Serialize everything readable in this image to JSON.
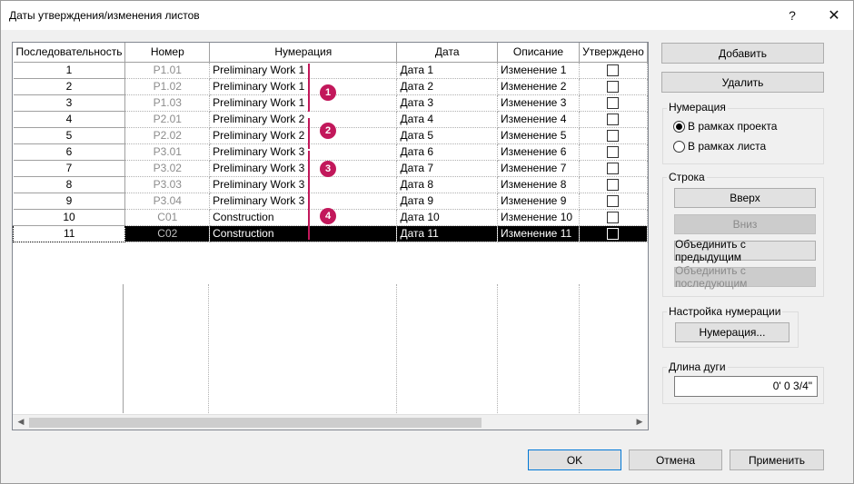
{
  "window": {
    "title": "Даты утверждения/изменения листов",
    "help_label": "?",
    "close_label": "✕"
  },
  "table": {
    "columns": [
      "Последовательность",
      "Номер",
      "Нумерация",
      "Дата",
      "Описание",
      "Утверждено"
    ],
    "rows": [
      {
        "seq": "1",
        "num": "P1.01",
        "numbering": "Preliminary Work 1",
        "date": "Дата 1",
        "desc": "Изменение 1",
        "approved": false
      },
      {
        "seq": "2",
        "num": "P1.02",
        "numbering": "Preliminary Work 1",
        "date": "Дата 2",
        "desc": "Изменение 2",
        "approved": false
      },
      {
        "seq": "3",
        "num": "P1.03",
        "numbering": "Preliminary Work 1",
        "date": "Дата 3",
        "desc": "Изменение 3",
        "approved": false
      },
      {
        "seq": "4",
        "num": "P2.01",
        "numbering": "Preliminary Work 2",
        "date": "Дата 4",
        "desc": "Изменение 4",
        "approved": false
      },
      {
        "seq": "5",
        "num": "P2.02",
        "numbering": "Preliminary Work 2",
        "date": "Дата 5",
        "desc": "Изменение 5",
        "approved": false
      },
      {
        "seq": "6",
        "num": "P3.01",
        "numbering": "Preliminary Work 3",
        "date": "Дата 6",
        "desc": "Изменение 6",
        "approved": false
      },
      {
        "seq": "7",
        "num": "P3.02",
        "numbering": "Preliminary Work 3",
        "date": "Дата 7",
        "desc": "Изменение 7",
        "approved": false
      },
      {
        "seq": "8",
        "num": "P3.03",
        "numbering": "Preliminary Work 3",
        "date": "Дата 8",
        "desc": "Изменение 8",
        "approved": false
      },
      {
        "seq": "9",
        "num": "P3.04",
        "numbering": "Preliminary Work 3",
        "date": "Дата 9",
        "desc": "Изменение 9",
        "approved": false
      },
      {
        "seq": "10",
        "num": "C01",
        "numbering": "Construction",
        "date": "Дата 10",
        "desc": "Изменение 10",
        "approved": false
      },
      {
        "seq": "11",
        "num": "C02",
        "numbering": "Construction",
        "date": "Дата 11",
        "desc": "Изменение 11",
        "approved": false
      }
    ],
    "selected_row": "11"
  },
  "markers": [
    "1",
    "2",
    "3",
    "4"
  ],
  "marker_color": "#c2185b",
  "buttons": {
    "add": "Добавить",
    "delete": "Удалить"
  },
  "numbering_group": {
    "label": "Нумерация",
    "options": [
      "В рамках проекта",
      "В рамках листа"
    ],
    "selected": "В рамках проекта"
  },
  "row_group": {
    "label": "Строка",
    "up": "Вверх",
    "down": "Вниз",
    "merge_prev": "Объединить с предыдущим",
    "merge_next": "Объединить с последующим"
  },
  "numbering_settings": {
    "label": "Настройка нумерации",
    "button": "Нумерация..."
  },
  "arc_length": {
    "label": "Длина дуги",
    "value": "0'  0 3/4\""
  },
  "footer": {
    "ok": "OK",
    "cancel": "Отмена",
    "apply": "Применить"
  }
}
